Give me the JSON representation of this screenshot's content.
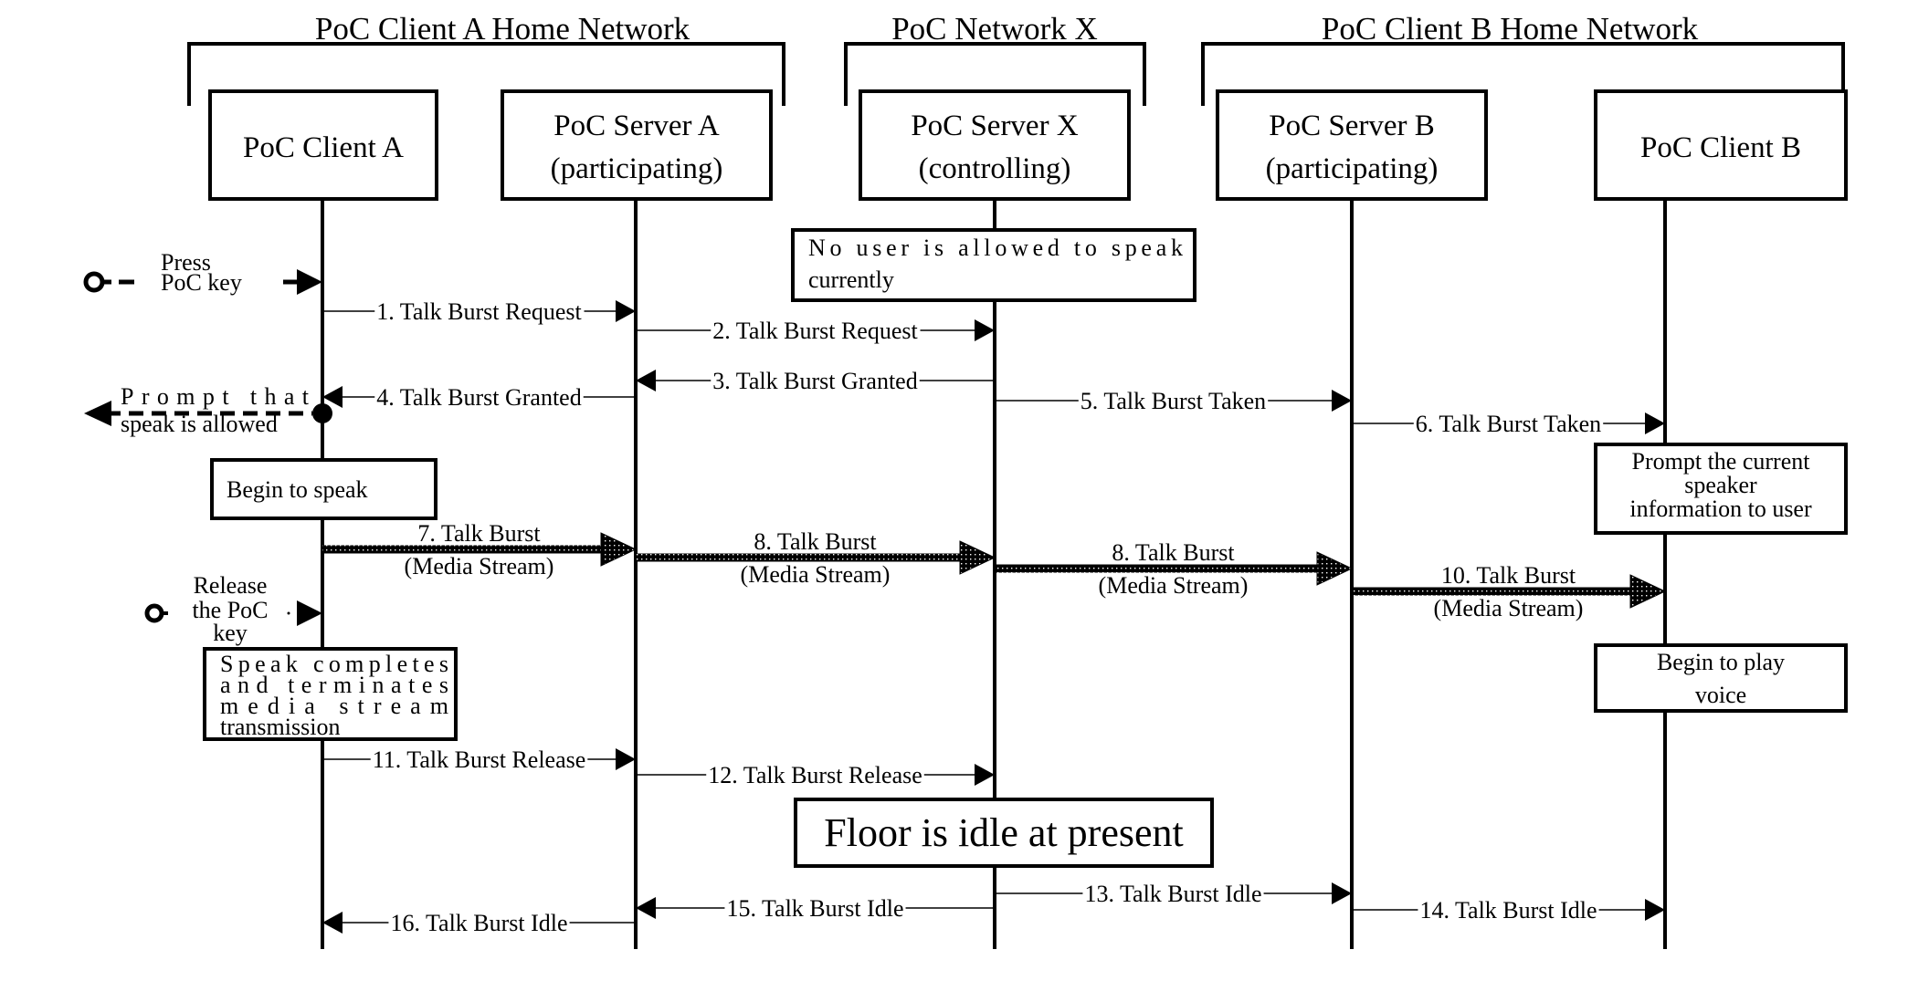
{
  "diagram": {
    "groups": [
      {
        "id": "client-a-home",
        "title": "PoC Client A Home Network"
      },
      {
        "id": "network-x",
        "title": "PoC Network X"
      },
      {
        "id": "client-b-home",
        "title": "PoC Client B Home Network"
      }
    ],
    "participants": [
      {
        "id": "client-a",
        "lines": [
          "PoC Client A"
        ]
      },
      {
        "id": "server-a",
        "lines": [
          "PoC Server A",
          "(participating)"
        ]
      },
      {
        "id": "server-x",
        "lines": [
          "PoC Server X",
          "(controlling)"
        ]
      },
      {
        "id": "server-b",
        "lines": [
          "PoC Server B",
          "(participating)"
        ]
      },
      {
        "id": "client-b",
        "lines": [
          "PoC Client B"
        ]
      }
    ],
    "messages": [
      {
        "id": "m1",
        "label": "1. Talk Burst Request",
        "from": "client-a",
        "to": "server-a",
        "kind": "signal"
      },
      {
        "id": "m2",
        "label": "2. Talk Burst Request",
        "from": "server-a",
        "to": "server-x",
        "kind": "signal"
      },
      {
        "id": "m3",
        "label": "3. Talk Burst Granted",
        "from": "server-x",
        "to": "server-a",
        "kind": "signal"
      },
      {
        "id": "m4",
        "label": "4. Talk Burst Granted",
        "from": "server-a",
        "to": "client-a",
        "kind": "signal"
      },
      {
        "id": "m5",
        "label": "5. Talk Burst Taken",
        "from": "server-x",
        "to": "server-b",
        "kind": "signal"
      },
      {
        "id": "m6",
        "label": "6. Talk Burst Taken",
        "from": "server-b",
        "to": "client-b",
        "kind": "signal"
      },
      {
        "id": "m7",
        "label": "7. Talk Burst",
        "sublabel": "(Media Stream)",
        "from": "client-a",
        "to": "server-a",
        "kind": "media"
      },
      {
        "id": "m8a",
        "label": "8. Talk Burst",
        "sublabel": "(Media Stream)",
        "from": "server-a",
        "to": "server-x",
        "kind": "media"
      },
      {
        "id": "m8b",
        "label": "8. Talk Burst",
        "sublabel": "(Media Stream)",
        "from": "server-x",
        "to": "server-b",
        "kind": "media"
      },
      {
        "id": "m10",
        "label": "10. Talk Burst",
        "sublabel": "(Media Stream)",
        "from": "server-b",
        "to": "client-b",
        "kind": "media"
      },
      {
        "id": "m11",
        "label": "11. Talk Burst Release",
        "from": "client-a",
        "to": "server-a",
        "kind": "signal"
      },
      {
        "id": "m12",
        "label": "12. Talk Burst Release",
        "from": "server-a",
        "to": "server-x",
        "kind": "signal"
      },
      {
        "id": "m13",
        "label": "13. Talk Burst Idle",
        "from": "server-x",
        "to": "server-b",
        "kind": "signal"
      },
      {
        "id": "m14",
        "label": "14. Talk Burst Idle",
        "from": "server-b",
        "to": "client-b",
        "kind": "signal"
      },
      {
        "id": "m15",
        "label": "15. Talk Burst Idle",
        "from": "server-x",
        "to": "server-a",
        "kind": "signal"
      },
      {
        "id": "m16",
        "label": "16. Talk Burst Idle",
        "from": "server-a",
        "to": "client-a",
        "kind": "signal"
      }
    ],
    "notes": [
      {
        "id": "no-user-allowed",
        "lines": [
          "No user is allowed to speak",
          "currently"
        ]
      },
      {
        "id": "begin-to-speak",
        "lines": [
          "Begin to speak"
        ]
      },
      {
        "id": "prompt-current-speaker",
        "lines": [
          "Prompt the current",
          "speaker",
          "information to user"
        ]
      },
      {
        "id": "speak-completes",
        "lines": [
          "Speak completes",
          "and terminates",
          "media stream",
          "transmission"
        ]
      },
      {
        "id": "begin-to-play-voice",
        "lines": [
          "Begin to play",
          "voice"
        ]
      },
      {
        "id": "floor-idle",
        "lines": [
          "Floor is idle at present"
        ]
      }
    ],
    "user_actions": [
      {
        "id": "press-poc-key",
        "lines": [
          "Press",
          "PoC key"
        ]
      },
      {
        "id": "prompt-speak-allowed",
        "lines": [
          "Prompt that",
          "speak is allowed"
        ]
      },
      {
        "id": "release-poc-key",
        "lines": [
          "Release",
          "the PoC",
          "key"
        ]
      }
    ]
  }
}
